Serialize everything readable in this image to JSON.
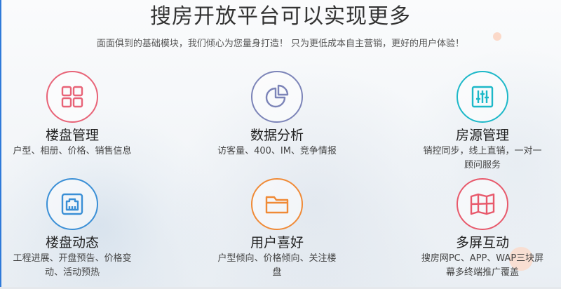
{
  "header": {
    "title": "搜房开放平台可以实现更多",
    "subtitle": "面面俱到的基础模块，我们倾心为您量身打造！ 只为更低成本自主营销，更好的用户体验！"
  },
  "features": [
    {
      "icon": "grid-icon",
      "color": "#e86377",
      "title": "楼盘管理",
      "desc": [
        "户型、相册、价格、销售信息"
      ]
    },
    {
      "icon": "pie-chart-icon",
      "color": "#7c84b8",
      "title": "数据分析",
      "desc": [
        "访客量、400、IM、竞争情报"
      ]
    },
    {
      "icon": "sliders-icon",
      "color": "#1cb8c8",
      "title": "房源管理",
      "desc": [
        "销控同步，线上直销，一对一",
        "顾问服务"
      ]
    },
    {
      "icon": "ethernet-port-icon",
      "color": "#3a8fd6",
      "title": "楼盘动态",
      "desc": [
        "工程进展、开盘预告、价格变",
        "动、活动预热"
      ]
    },
    {
      "icon": "folder-icon",
      "color": "#f08a36",
      "title": "用户喜好",
      "desc": [
        "户型倾向、价格倾向、关注楼",
        "盘"
      ]
    },
    {
      "icon": "multi-screen-icon",
      "color": "#e8596b",
      "title": "多屏互动",
      "desc": [
        "搜房网PC、APP、WAP三块屏",
        "幕多终端推广覆盖"
      ]
    }
  ]
}
